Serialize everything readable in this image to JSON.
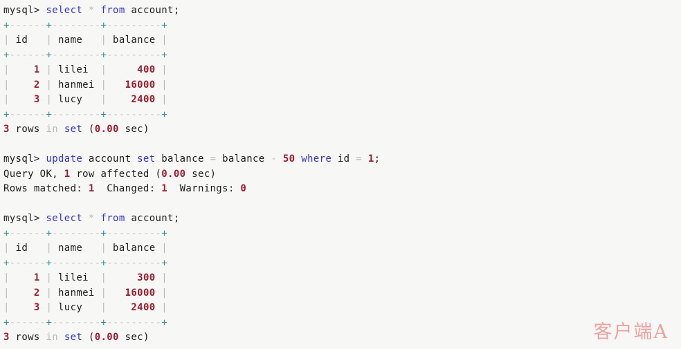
{
  "terminal": {
    "app": "mysql-client",
    "prompt": "mysql> ",
    "colors": {
      "background": "#f7f7f5",
      "text": "#1c1c1c",
      "keyword": "#3333cc",
      "number": "#9b1c2e",
      "dim": "#b9b9b4",
      "border_plus": "#3a8f9e",
      "border_dash": "#c9c9c4",
      "watermark": "#eba3a3"
    },
    "lines": [
      {
        "id": "cmd-select-1",
        "type": "command",
        "tokens": [
          {
            "t": "mysql> ",
            "c": "prompt"
          },
          {
            "t": "select",
            "c": "kw"
          },
          {
            "t": " ",
            "c": "txt"
          },
          {
            "t": "*",
            "c": "dim"
          },
          {
            "t": " ",
            "c": "txt"
          },
          {
            "t": "from",
            "c": "kw"
          },
          {
            "t": " account;",
            "c": "txt"
          }
        ]
      },
      {
        "id": "rule-1-top",
        "type": "rule",
        "tokens": [
          {
            "t": "+",
            "c": "plus"
          },
          {
            "t": "------",
            "c": "dash"
          },
          {
            "t": "+",
            "c": "plus"
          },
          {
            "t": "--------",
            "c": "dash"
          },
          {
            "t": "+",
            "c": "plus"
          },
          {
            "t": "---------",
            "c": "dash"
          },
          {
            "t": "+",
            "c": "plus"
          }
        ]
      },
      {
        "id": "header-1",
        "type": "row",
        "tokens": [
          {
            "t": "|",
            "c": "pipe"
          },
          {
            "t": " id   ",
            "c": "txt"
          },
          {
            "t": "|",
            "c": "pipe"
          },
          {
            "t": " name   ",
            "c": "txt"
          },
          {
            "t": "|",
            "c": "pipe"
          },
          {
            "t": " balance ",
            "c": "txt"
          },
          {
            "t": "|",
            "c": "pipe"
          }
        ]
      },
      {
        "id": "rule-1-mid",
        "type": "rule",
        "tokens": [
          {
            "t": "+",
            "c": "plus"
          },
          {
            "t": "------",
            "c": "dash"
          },
          {
            "t": "+",
            "c": "plus"
          },
          {
            "t": "--------",
            "c": "dash"
          },
          {
            "t": "+",
            "c": "plus"
          },
          {
            "t": "---------",
            "c": "dash"
          },
          {
            "t": "+",
            "c": "plus"
          }
        ]
      },
      {
        "id": "row-1-1",
        "type": "row",
        "tokens": [
          {
            "t": "|",
            "c": "pipe"
          },
          {
            "t": "    ",
            "c": "txt"
          },
          {
            "t": "1",
            "c": "num"
          },
          {
            "t": " ",
            "c": "txt"
          },
          {
            "t": "|",
            "c": "pipe"
          },
          {
            "t": " lilei  ",
            "c": "txt"
          },
          {
            "t": "|",
            "c": "pipe"
          },
          {
            "t": "     ",
            "c": "txt"
          },
          {
            "t": "400",
            "c": "num"
          },
          {
            "t": " ",
            "c": "txt"
          },
          {
            "t": "|",
            "c": "pipe"
          }
        ]
      },
      {
        "id": "row-1-2",
        "type": "row",
        "tokens": [
          {
            "t": "|",
            "c": "pipe"
          },
          {
            "t": "    ",
            "c": "txt"
          },
          {
            "t": "2",
            "c": "num"
          },
          {
            "t": " ",
            "c": "txt"
          },
          {
            "t": "|",
            "c": "pipe"
          },
          {
            "t": " hanmei ",
            "c": "txt"
          },
          {
            "t": "|",
            "c": "pipe"
          },
          {
            "t": "   ",
            "c": "txt"
          },
          {
            "t": "16000",
            "c": "num"
          },
          {
            "t": " ",
            "c": "txt"
          },
          {
            "t": "|",
            "c": "pipe"
          }
        ]
      },
      {
        "id": "row-1-3",
        "type": "row",
        "tokens": [
          {
            "t": "|",
            "c": "pipe"
          },
          {
            "t": "    ",
            "c": "txt"
          },
          {
            "t": "3",
            "c": "num"
          },
          {
            "t": " ",
            "c": "txt"
          },
          {
            "t": "|",
            "c": "pipe"
          },
          {
            "t": " lucy   ",
            "c": "txt"
          },
          {
            "t": "|",
            "c": "pipe"
          },
          {
            "t": "    ",
            "c": "txt"
          },
          {
            "t": "2400",
            "c": "num"
          },
          {
            "t": " ",
            "c": "txt"
          },
          {
            "t": "|",
            "c": "pipe"
          }
        ]
      },
      {
        "id": "rule-1-bot",
        "type": "rule",
        "tokens": [
          {
            "t": "+",
            "c": "plus"
          },
          {
            "t": "------",
            "c": "dash"
          },
          {
            "t": "+",
            "c": "plus"
          },
          {
            "t": "--------",
            "c": "dash"
          },
          {
            "t": "+",
            "c": "plus"
          },
          {
            "t": "---------",
            "c": "dash"
          },
          {
            "t": "+",
            "c": "plus"
          }
        ]
      },
      {
        "id": "status-1",
        "type": "status",
        "tokens": [
          {
            "t": "3",
            "c": "num"
          },
          {
            "t": " rows ",
            "c": "txt"
          },
          {
            "t": "in",
            "c": "dim"
          },
          {
            "t": " ",
            "c": "txt"
          },
          {
            "t": "set",
            "c": "kw"
          },
          {
            "t": " (",
            "c": "txt"
          },
          {
            "t": "0.00",
            "c": "num"
          },
          {
            "t": " sec)",
            "c": "txt"
          }
        ]
      },
      {
        "id": "blank-1",
        "type": "blank",
        "tokens": [
          {
            "t": " ",
            "c": "txt"
          }
        ]
      },
      {
        "id": "cmd-update",
        "type": "command",
        "tokens": [
          {
            "t": "mysql> ",
            "c": "prompt"
          },
          {
            "t": "update",
            "c": "kw"
          },
          {
            "t": " account ",
            "c": "txt"
          },
          {
            "t": "set",
            "c": "kw"
          },
          {
            "t": " balance ",
            "c": "txt"
          },
          {
            "t": "=",
            "c": "dim"
          },
          {
            "t": " balance ",
            "c": "txt"
          },
          {
            "t": "-",
            "c": "dim"
          },
          {
            "t": " ",
            "c": "txt"
          },
          {
            "t": "50",
            "c": "num"
          },
          {
            "t": " ",
            "c": "txt"
          },
          {
            "t": "where",
            "c": "kw"
          },
          {
            "t": " id ",
            "c": "txt"
          },
          {
            "t": "=",
            "c": "dim"
          },
          {
            "t": " ",
            "c": "txt"
          },
          {
            "t": "1",
            "c": "num"
          },
          {
            "t": ";",
            "c": "txt"
          }
        ]
      },
      {
        "id": "query-ok",
        "type": "status",
        "tokens": [
          {
            "t": "Query OK, ",
            "c": "txt"
          },
          {
            "t": "1",
            "c": "num"
          },
          {
            "t": " row affected (",
            "c": "txt"
          },
          {
            "t": "0.00",
            "c": "num"
          },
          {
            "t": " sec)",
            "c": "txt"
          }
        ]
      },
      {
        "id": "rows-matched",
        "type": "status",
        "tokens": [
          {
            "t": "Rows matched: ",
            "c": "txt"
          },
          {
            "t": "1",
            "c": "num"
          },
          {
            "t": "  Changed: ",
            "c": "txt"
          },
          {
            "t": "1",
            "c": "num"
          },
          {
            "t": "  Warnings: ",
            "c": "txt"
          },
          {
            "t": "0",
            "c": "num"
          }
        ]
      },
      {
        "id": "blank-2",
        "type": "blank",
        "tokens": [
          {
            "t": " ",
            "c": "txt"
          }
        ]
      },
      {
        "id": "cmd-select-2",
        "type": "command",
        "tokens": [
          {
            "t": "mysql> ",
            "c": "prompt"
          },
          {
            "t": "select",
            "c": "kw"
          },
          {
            "t": " ",
            "c": "txt"
          },
          {
            "t": "*",
            "c": "dim"
          },
          {
            "t": " ",
            "c": "txt"
          },
          {
            "t": "from",
            "c": "kw"
          },
          {
            "t": " account;",
            "c": "txt"
          }
        ]
      },
      {
        "id": "rule-2-top",
        "type": "rule",
        "tokens": [
          {
            "t": "+",
            "c": "plus"
          },
          {
            "t": "------",
            "c": "dash"
          },
          {
            "t": "+",
            "c": "plus"
          },
          {
            "t": "--------",
            "c": "dash"
          },
          {
            "t": "+",
            "c": "plus"
          },
          {
            "t": "---------",
            "c": "dash"
          },
          {
            "t": "+",
            "c": "plus"
          }
        ]
      },
      {
        "id": "header-2",
        "type": "row",
        "tokens": [
          {
            "t": "|",
            "c": "pipe"
          },
          {
            "t": " id   ",
            "c": "txt"
          },
          {
            "t": "|",
            "c": "pipe"
          },
          {
            "t": " name   ",
            "c": "txt"
          },
          {
            "t": "|",
            "c": "pipe"
          },
          {
            "t": " balance ",
            "c": "txt"
          },
          {
            "t": "|",
            "c": "pipe"
          }
        ]
      },
      {
        "id": "rule-2-mid",
        "type": "rule",
        "tokens": [
          {
            "t": "+",
            "c": "plus"
          },
          {
            "t": "------",
            "c": "dash"
          },
          {
            "t": "+",
            "c": "plus"
          },
          {
            "t": "--------",
            "c": "dash"
          },
          {
            "t": "+",
            "c": "plus"
          },
          {
            "t": "---------",
            "c": "dash"
          },
          {
            "t": "+",
            "c": "plus"
          }
        ]
      },
      {
        "id": "row-2-1",
        "type": "row",
        "tokens": [
          {
            "t": "|",
            "c": "pipe"
          },
          {
            "t": "    ",
            "c": "txt"
          },
          {
            "t": "1",
            "c": "num"
          },
          {
            "t": " ",
            "c": "txt"
          },
          {
            "t": "|",
            "c": "pipe"
          },
          {
            "t": " lilei  ",
            "c": "txt"
          },
          {
            "t": "|",
            "c": "pipe"
          },
          {
            "t": "     ",
            "c": "txt"
          },
          {
            "t": "300",
            "c": "num"
          },
          {
            "t": " ",
            "c": "txt"
          },
          {
            "t": "|",
            "c": "pipe"
          }
        ]
      },
      {
        "id": "row-2-2",
        "type": "row",
        "tokens": [
          {
            "t": "|",
            "c": "pipe"
          },
          {
            "t": "    ",
            "c": "txt"
          },
          {
            "t": "2",
            "c": "num"
          },
          {
            "t": " ",
            "c": "txt"
          },
          {
            "t": "|",
            "c": "pipe"
          },
          {
            "t": " hanmei ",
            "c": "txt"
          },
          {
            "t": "|",
            "c": "pipe"
          },
          {
            "t": "   ",
            "c": "txt"
          },
          {
            "t": "16000",
            "c": "num"
          },
          {
            "t": " ",
            "c": "txt"
          },
          {
            "t": "|",
            "c": "pipe"
          }
        ]
      },
      {
        "id": "row-2-3",
        "type": "row",
        "tokens": [
          {
            "t": "|",
            "c": "pipe"
          },
          {
            "t": "    ",
            "c": "txt"
          },
          {
            "t": "3",
            "c": "num"
          },
          {
            "t": " ",
            "c": "txt"
          },
          {
            "t": "|",
            "c": "pipe"
          },
          {
            "t": " lucy   ",
            "c": "txt"
          },
          {
            "t": "|",
            "c": "pipe"
          },
          {
            "t": "    ",
            "c": "txt"
          },
          {
            "t": "2400",
            "c": "num"
          },
          {
            "t": " ",
            "c": "txt"
          },
          {
            "t": "|",
            "c": "pipe"
          }
        ]
      },
      {
        "id": "rule-2-bot",
        "type": "rule",
        "tokens": [
          {
            "t": "+",
            "c": "plus"
          },
          {
            "t": "------",
            "c": "dash"
          },
          {
            "t": "+",
            "c": "plus"
          },
          {
            "t": "--------",
            "c": "dash"
          },
          {
            "t": "+",
            "c": "plus"
          },
          {
            "t": "---------",
            "c": "dash"
          },
          {
            "t": "+",
            "c": "plus"
          }
        ]
      },
      {
        "id": "status-2",
        "type": "status",
        "tokens": [
          {
            "t": "3",
            "c": "num"
          },
          {
            "t": " rows ",
            "c": "txt"
          },
          {
            "t": "in",
            "c": "dim"
          },
          {
            "t": " ",
            "c": "txt"
          },
          {
            "t": "set",
            "c": "kw"
          },
          {
            "t": " (",
            "c": "txt"
          },
          {
            "t": "0.00",
            "c": "num"
          },
          {
            "t": " sec)",
            "c": "txt"
          }
        ]
      }
    ],
    "tables": [
      {
        "name": "account-before-update",
        "columns": [
          "id",
          "name",
          "balance"
        ],
        "rows": [
          [
            "1",
            "lilei",
            "400"
          ],
          [
            "2",
            "hanmei",
            "16000"
          ],
          [
            "3",
            "lucy",
            "2400"
          ]
        ],
        "footer": "3 rows in set (0.00 sec)"
      },
      {
        "name": "account-after-update",
        "columns": [
          "id",
          "name",
          "balance"
        ],
        "rows": [
          [
            "1",
            "lilei",
            "300"
          ],
          [
            "2",
            "hanmei",
            "16000"
          ],
          [
            "3",
            "lucy",
            "2400"
          ]
        ],
        "footer": "3 rows in set (0.00 sec)"
      }
    ],
    "statements": [
      "select * from account;",
      "update account set balance = balance - 50 where id = 1;",
      "select * from account;"
    ]
  },
  "watermark": {
    "text": "客户端A"
  }
}
